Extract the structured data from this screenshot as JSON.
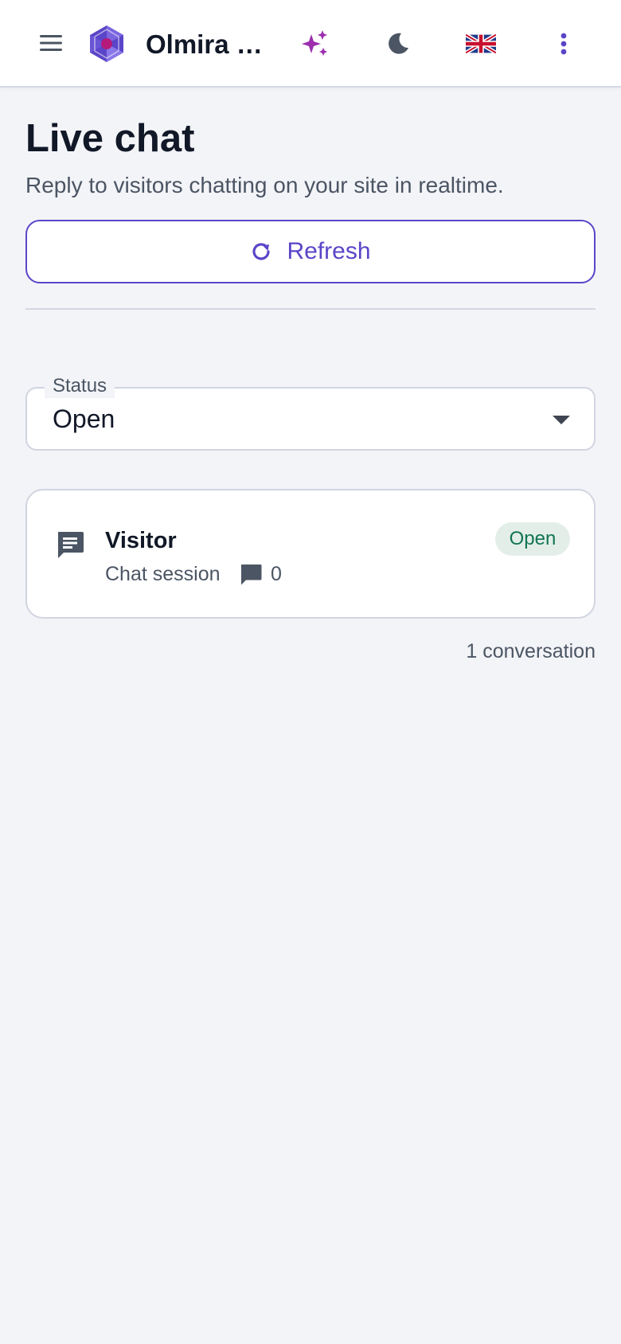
{
  "app": {
    "title": "Olmira C...",
    "icons": [
      "hamburger-menu-icon",
      "hexagon-logo",
      "sparkle-icon",
      "moon-icon",
      "uk-flag-icon",
      "more-vertical-icon"
    ],
    "colors": {
      "brand": "#5b45c8",
      "sparkle": "#9b2fae",
      "icon_gray": "#4b5563",
      "status_open_bg": "#e3eee9",
      "status_open_text": "#127553"
    }
  },
  "page": {
    "title": "Live chat",
    "subtitle": "Reply to visitors chatting on your site in realtime.",
    "refresh_label": "Refresh",
    "refresh_icon": "refresh-icon"
  },
  "filter": {
    "label": "Status",
    "value": "Open"
  },
  "conversations": [
    {
      "icon": "chat-icon",
      "name": "Visitor",
      "type": "Chat session",
      "message_icon": "message-icon",
      "message_count": "0",
      "status": "Open"
    }
  ],
  "summary": "1 conversation"
}
